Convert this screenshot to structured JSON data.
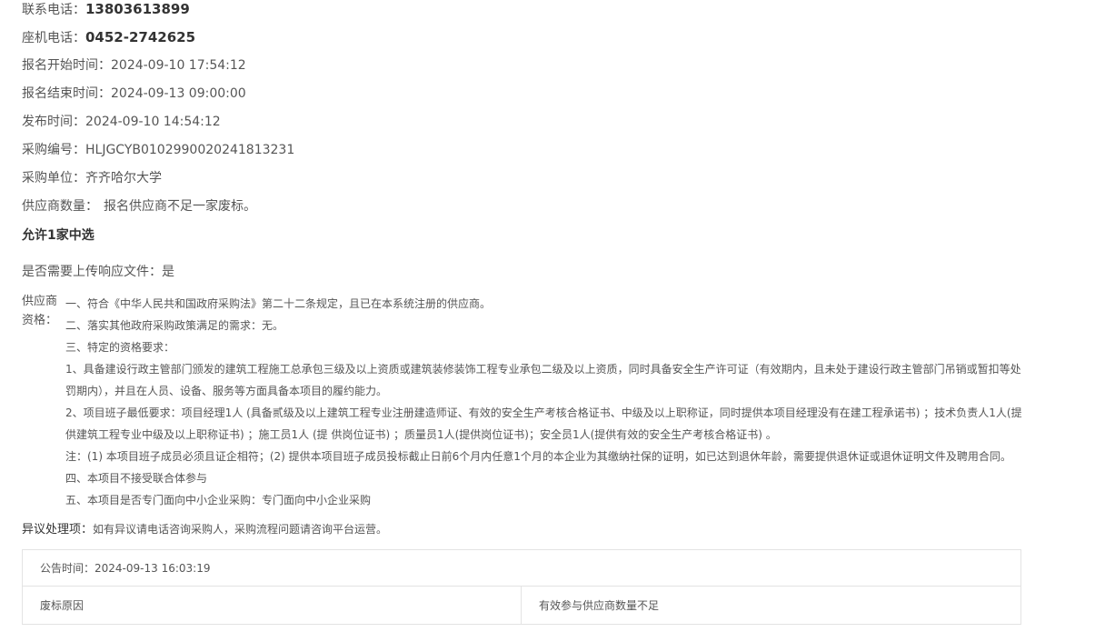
{
  "contact": {
    "phone_label": "联系电话：",
    "phone_value": "13803613899",
    "landline_label": "座机电话：",
    "landline_value": "0452-2742625"
  },
  "registration": {
    "start_label": "报名开始时间：",
    "start_value": "2024-09-10 17:54:12",
    "end_label": "报名结束时间：",
    "end_value": "2024-09-13 09:00:00"
  },
  "publish": {
    "label": "发布时间：",
    "value": "2024-09-10 14:54:12"
  },
  "procurement": {
    "number_label": "采购编号：",
    "number_value": "HLJGCYB0102990020241813231",
    "unit_label": "采购单位：",
    "unit_value": "齐齐哈尔大学"
  },
  "suppliers": {
    "count_label": "供应商数量：",
    "count_value": "报名供应商不足一家废标。",
    "allow_text": "允许1家中选"
  },
  "upload": {
    "label": "是否需要上传响应文件：",
    "value": "是"
  },
  "qualification": {
    "label": "供应商资格：",
    "lines": [
      "一、符合《中华人民共和国政府采购法》第二十二条规定，且已在本系统注册的供应商。",
      "二、落实其他政府采购政策满足的需求：无。",
      "三、特定的资格要求：",
      "1、具备建设行政主管部门颁发的建筑工程施工总承包三级及以上资质或建筑装修装饰工程专业承包二级及以上资质，同时具备安全生产许可证（有效期内，且未处于建设行政主管部门吊销或暂扣等处罚期内），并且在人员、设备、服务等方面具备本项目的履约能力。",
      "2、项目班子最低要求：项目经理1人 (具备贰级及以上建筑工程专业注册建造师证、有效的安全生产考核合格证书、中级及以上职称证，同时提供本项目经理没有在建工程承诺书) ；技术负责人1人(提供建筑工程专业中级及以上职称证书) ；施工员1人 (提 供岗位证书) ；质量员1人(提供岗位证书)；安全员1人(提供有效的安全生产考核合格证书) 。",
      "注：(1) 本项目班子成员必须且证企相符；(2) 提供本项目班子成员投标截止日前6个月内任意1个月的本企业为其缴纳社保的证明，如已达到退休年龄，需要提供退休证或退休证明文件及聘用合同。",
      "四、本项目不接受联合体参与",
      "五、本项目是否专门面向中小企业采购：专门面向中小企业采购"
    ]
  },
  "objection": {
    "label": "异议处理项：",
    "value": "如有异议请电话咨询采购人，采购流程问题请咨询平台运营。"
  },
  "notice_table": {
    "time_label": "公告时间：",
    "time_value": "2024-09-13 16:03:19",
    "reason_label": "废标原因",
    "reason_value": "有效参与供应商数量不足"
  }
}
